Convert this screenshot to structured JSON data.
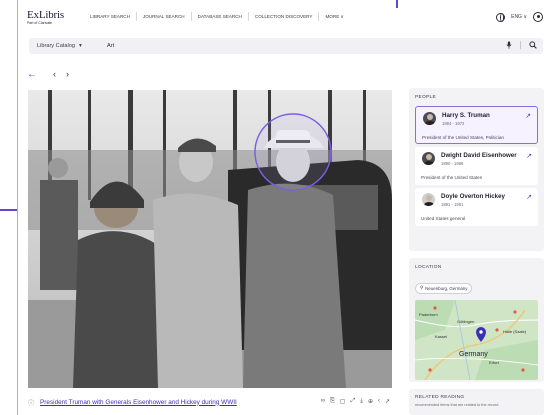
{
  "logo": {
    "main": "ExLibris",
    "sub": "Part of Clarivate"
  },
  "nav": {
    "links": [
      "LIBRARY SEARCH",
      "JOURNAL SEARCH",
      "DATABASE SEARCH",
      "COLLECTION DISCOVERY",
      "MORE ∨"
    ],
    "lang": "ENG ∨"
  },
  "search": {
    "scope": "Library Catalog",
    "scope_caret": "▾",
    "value": "Art"
  },
  "photo": {
    "caption": "President Truman with Generals Eisenhower and Hickey during WWII",
    "tools": [
      "∞",
      "⎘",
      "▢",
      "⤢",
      "⤓",
      "⊕",
      "‹",
      "↗"
    ]
  },
  "people": {
    "title": "PEOPLE",
    "items": [
      {
        "name": "Harry S. Truman",
        "years": "1884 - 1972",
        "desc": "President of the United States, Politician",
        "active": true
      },
      {
        "name": "Dwight David Eisenhower",
        "years": "1890 - 1969",
        "desc": "President of the United States",
        "active": false
      },
      {
        "name": "Doyle Overton Hickey",
        "years": "1891 - 1961",
        "desc": "United States general",
        "active": false
      }
    ]
  },
  "location": {
    "title": "LOCATION",
    "chip": "Neuenburg, Germany",
    "map_labels": [
      "Paderborn",
      "Göttingen",
      "Kassel",
      "Halle (Saale)",
      "Germany",
      "Erfurt"
    ]
  },
  "related": {
    "title": "RELATED READING",
    "subtitle": "recommended items that are related to the record"
  },
  "colors": {
    "accent": "#4b3cb8",
    "highlight": "#8a6ee0",
    "panel": "#f3f3f6"
  }
}
